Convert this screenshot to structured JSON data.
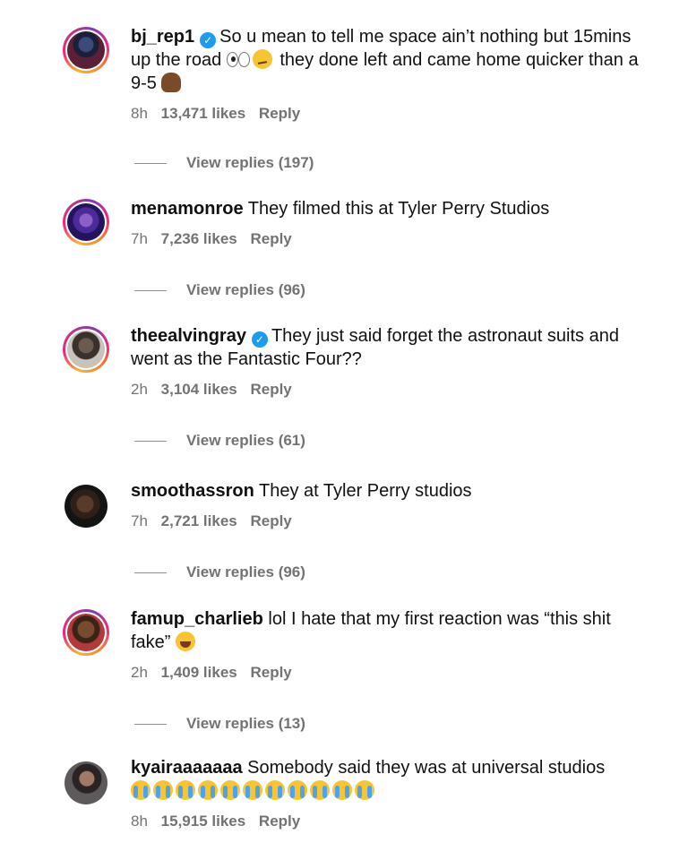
{
  "comments": [
    {
      "username": "bj_rep1",
      "verified": true,
      "text_parts": [
        "So u mean to tell me space ain’t nothing but 15mins up the road",
        "they done left and came home quicker than a 9-5"
      ],
      "time": "8h",
      "likes": "13,471 likes",
      "reply": "Reply",
      "view_replies": "View replies (197)"
    },
    {
      "username": "menamonroe",
      "verified": false,
      "text": "They filmed this at Tyler Perry Studios",
      "time": "7h",
      "likes": "7,236 likes",
      "reply": "Reply",
      "view_replies": "View replies (96)"
    },
    {
      "username": "theealvingray",
      "verified": true,
      "text": "They just said forget the astronaut suits and went as the Fantastic Four??",
      "time": "2h",
      "likes": "3,104 likes",
      "reply": "Reply",
      "view_replies": "View replies (61)"
    },
    {
      "username": "smoothassron",
      "verified": false,
      "text": "They at Tyler Perry studios",
      "time": "7h",
      "likes": "2,721 likes",
      "reply": "Reply",
      "view_replies": "View replies (96)"
    },
    {
      "username": "famup_charlieb",
      "verified": false,
      "text": "lol I hate that my first reaction was “this shit fake”",
      "time": "2h",
      "likes": "1,409 likes",
      "reply": "Reply",
      "view_replies": "View replies (13)"
    },
    {
      "username": "kyairaaaaaaa",
      "verified": false,
      "text": "Somebody said they was at universal studios",
      "time": "8h",
      "likes": "15,915 likes",
      "reply": "Reply"
    }
  ],
  "icons": {
    "verified_badge": "checkmark-badge-icon",
    "emoji_eyes": "eyes-emoji-icon",
    "emoji_smirk": "smirk-emoji-icon",
    "emoji_person": "person-emoji-icon",
    "emoji_laugh": "laughing-emoji-icon",
    "emoji_cry": "loudly-crying-emoji-icon"
  },
  "colors": {
    "verified": "#1d9bf0",
    "meta_text": "#737373",
    "text": "#111111"
  }
}
